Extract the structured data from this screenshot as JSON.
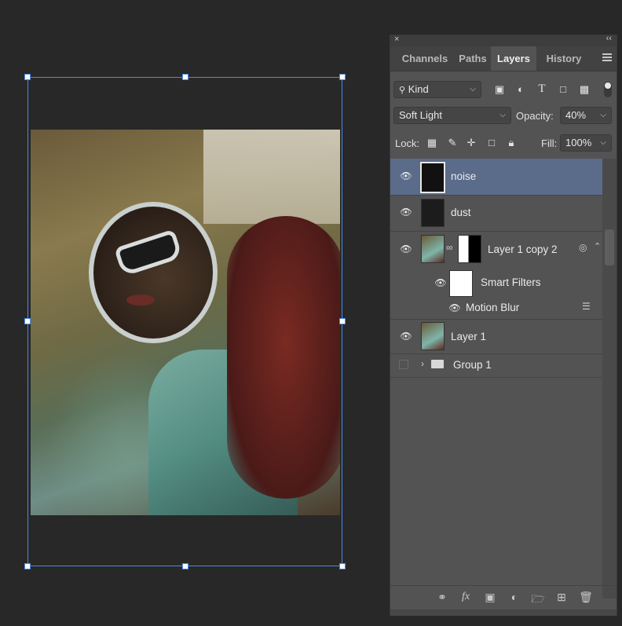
{
  "panel": {
    "close_glyph": "×",
    "collapse_glyph": "‹‹",
    "tabs": [
      {
        "label": "Channels"
      },
      {
        "label": "Paths"
      },
      {
        "label": "Layers",
        "active": true
      },
      {
        "label": "History"
      }
    ],
    "filter": {
      "label": "Kind"
    },
    "blend_mode": "Soft Light",
    "opacity_label": "Opacity:",
    "opacity_value": "40%",
    "lock_label": "Lock:",
    "fill_label": "Fill:",
    "fill_value": "100%",
    "accent_color": "#5b6b8a"
  },
  "layers": [
    {
      "name": "noise",
      "visible": true,
      "selected": true
    },
    {
      "name": "dust",
      "visible": true
    },
    {
      "name": "Layer 1 copy 2",
      "visible": true,
      "smart_object": true,
      "has_mask": true
    },
    {
      "name": "Smart Filters",
      "visible": true
    },
    {
      "name": "Motion Blur",
      "visible": true
    },
    {
      "name": "Layer 1",
      "visible": true,
      "smart_object": true
    },
    {
      "name": "Group 1",
      "visible": false,
      "type": "group",
      "collapsed": true
    }
  ],
  "bottom_icons": [
    "link-icon",
    "fx-icon",
    "mask-icon",
    "adjustment-icon",
    "folder-icon",
    "new-layer-icon",
    "trash-icon"
  ],
  "fx_label": "fx"
}
